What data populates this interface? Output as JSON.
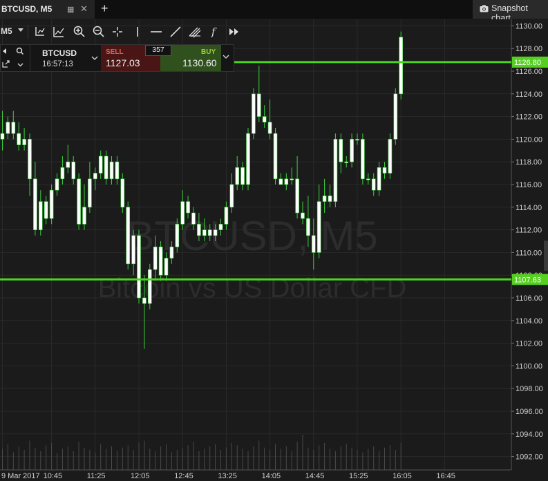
{
  "tab": {
    "title": "BTCUSD, M5",
    "grid_icon": "grid-icon",
    "close_icon": "close-icon"
  },
  "add_tab_icon": "plus-icon",
  "snapshot": {
    "label": "Snapshot chart",
    "icon": "camera-icon"
  },
  "toolbar": {
    "timeframe": "M5",
    "tools": [
      "chart-type-icon",
      "indicators-icon",
      "zoom-in-icon",
      "zoom-out-icon",
      "crosshair-icon",
      "vertical-line-icon",
      "horizontal-line-icon",
      "trend-line-icon",
      "fibonacci-icon",
      "function-icon",
      "fast-forward-icon"
    ]
  },
  "trade_panel": {
    "symbol": "BTCUSD",
    "time": "16:57:13",
    "sell_label": "SELL",
    "sell_price": "1127.03",
    "spread": "357",
    "buy_label": "BUY",
    "buy_price": "1130.60"
  },
  "colors": {
    "background": "#1b1b1b",
    "bull_candle": "#ffffff",
    "bear_candle": "#ffffff",
    "wick": "#3cd23c",
    "level_line": "#4bd61c",
    "level_label_bg": "#55d020"
  },
  "chart_data": {
    "type": "candlestick",
    "watermark_title": "BTCUSD, M5",
    "watermark_subtitle": "Bitcoin vs US Dollar CFD",
    "ylim": [
      1091,
      1131
    ],
    "y_ticks": [
      "1130.00",
      "1128.00",
      "1126.00",
      "1124.00",
      "1122.00",
      "1120.00",
      "1118.00",
      "1116.00",
      "1114.00",
      "1112.00",
      "1110.00",
      "1108.00",
      "1106.00",
      "1104.00",
      "1102.00",
      "1100.00",
      "1098.00",
      "1096.00",
      "1094.00",
      "1092.00"
    ],
    "x_ticks": [
      {
        "i": 0,
        "label": "9 Mar 2017"
      },
      {
        "i": 9,
        "label": "10:45"
      },
      {
        "i": 17,
        "label": "11:25"
      },
      {
        "i": 25,
        "label": "12:05"
      },
      {
        "i": 33,
        "label": "12:45"
      },
      {
        "i": 41,
        "label": "13:25"
      },
      {
        "i": 49,
        "label": "14:05"
      },
      {
        "i": 57,
        "label": "14:45"
      },
      {
        "i": 65,
        "label": "15:25"
      },
      {
        "i": 73,
        "label": "16:05"
      },
      {
        "i": 81,
        "label": "16:45"
      }
    ],
    "levels": [
      {
        "value": 1126.8,
        "label": "1126.80"
      },
      {
        "value": 1107.63,
        "label": "1107.63"
      }
    ],
    "candles": [
      [
        1120.0,
        1122.5,
        1119.0,
        1120.5
      ],
      [
        1120.5,
        1122.0,
        1120.0,
        1121.5
      ],
      [
        1121.5,
        1122.5,
        1120.0,
        1120.5
      ],
      [
        1120.5,
        1121.5,
        1119.0,
        1119.5
      ],
      [
        1119.5,
        1121.0,
        1119.0,
        1120.0
      ],
      [
        1120.0,
        1120.5,
        1115.0,
        1116.5
      ],
      [
        1116.5,
        1118.0,
        1111.5,
        1112.0
      ],
      [
        1112.0,
        1115.5,
        1111.5,
        1114.5
      ],
      [
        1114.5,
        1115.0,
        1112.5,
        1113.0
      ],
      [
        1113.0,
        1116.0,
        1112.5,
        1115.5
      ],
      [
        1115.5,
        1117.0,
        1115.0,
        1116.5
      ],
      [
        1116.5,
        1118.5,
        1116.0,
        1117.5
      ],
      [
        1117.5,
        1119.5,
        1117.0,
        1118.0
      ],
      [
        1118.0,
        1118.5,
        1116.0,
        1116.5
      ],
      [
        1116.5,
        1117.0,
        1112.0,
        1112.5
      ],
      [
        1112.5,
        1116.0,
        1112.0,
        1114.0
      ],
      [
        1114.0,
        1118.0,
        1113.5,
        1116.5
      ],
      [
        1116.5,
        1117.5,
        1115.5,
        1117.0
      ],
      [
        1117.0,
        1119.0,
        1116.5,
        1118.5
      ],
      [
        1118.5,
        1119.0,
        1116.0,
        1116.5
      ],
      [
        1116.5,
        1118.5,
        1116.0,
        1118.0
      ],
      [
        1118.0,
        1118.5,
        1116.0,
        1116.5
      ],
      [
        1116.5,
        1117.0,
        1113.5,
        1114.0
      ],
      [
        1114.0,
        1114.5,
        1108.5,
        1109.0
      ],
      [
        1109.0,
        1112.0,
        1108.0,
        1111.5
      ],
      [
        1111.5,
        1112.0,
        1105.5,
        1106.0
      ],
      [
        1106.0,
        1108.0,
        1101.5,
        1105.5
      ],
      [
        1105.5,
        1109.0,
        1105.0,
        1108.5
      ],
      [
        1108.5,
        1111.5,
        1107.5,
        1110.5
      ],
      [
        1110.5,
        1111.0,
        1107.5,
        1108.0
      ],
      [
        1108.0,
        1110.0,
        1107.5,
        1109.5
      ],
      [
        1109.5,
        1111.0,
        1109.0,
        1110.5
      ],
      [
        1110.5,
        1113.0,
        1110.0,
        1112.5
      ],
      [
        1112.5,
        1115.5,
        1112.0,
        1114.5
      ],
      [
        1114.5,
        1115.0,
        1113.0,
        1113.5
      ],
      [
        1113.5,
        1114.0,
        1112.0,
        1112.5
      ],
      [
        1112.5,
        1113.5,
        1111.0,
        1111.5
      ],
      [
        1111.5,
        1113.0,
        1111.0,
        1112.0
      ],
      [
        1112.0,
        1112.5,
        1111.0,
        1111.5
      ],
      [
        1111.5,
        1112.5,
        1111.0,
        1112.0
      ],
      [
        1112.0,
        1113.0,
        1111.5,
        1112.5
      ],
      [
        1112.5,
        1114.5,
        1112.0,
        1114.0
      ],
      [
        1114.0,
        1117.0,
        1113.5,
        1116.0
      ],
      [
        1116.0,
        1118.5,
        1115.5,
        1117.5
      ],
      [
        1117.5,
        1118.0,
        1115.5,
        1116.0
      ],
      [
        1116.0,
        1121.0,
        1115.5,
        1120.5
      ],
      [
        1120.5,
        1124.5,
        1120.0,
        1124.0
      ],
      [
        1124.0,
        1126.5,
        1121.5,
        1122.0
      ],
      [
        1122.0,
        1123.0,
        1121.0,
        1121.5
      ],
      [
        1121.5,
        1123.5,
        1120.0,
        1120.5
      ],
      [
        1120.5,
        1121.0,
        1116.0,
        1116.5
      ],
      [
        1116.5,
        1117.0,
        1116.0,
        1116.0
      ],
      [
        1116.0,
        1117.0,
        1115.5,
        1116.5
      ],
      [
        1116.5,
        1117.5,
        1116.0,
        1116.5
      ],
      [
        1116.5,
        1118.5,
        1113.0,
        1113.5
      ],
      [
        1113.5,
        1114.5,
        1112.5,
        1113.0
      ],
      [
        1113.0,
        1115.0,
        1110.5,
        1111.5
      ],
      [
        1111.5,
        1113.0,
        1108.5,
        1110.0
      ],
      [
        1110.0,
        1116.0,
        1109.5,
        1114.5
      ],
      [
        1114.5,
        1116.5,
        1113.5,
        1115.0
      ],
      [
        1115.0,
        1116.0,
        1114.0,
        1114.5
      ],
      [
        1114.5,
        1120.5,
        1114.0,
        1120.0
      ],
      [
        1120.0,
        1120.5,
        1117.0,
        1118.0
      ],
      [
        1118.0,
        1118.5,
        1117.5,
        1118.0
      ],
      [
        1118.0,
        1120.5,
        1117.5,
        1120.0
      ],
      [
        1120.0,
        1120.5,
        1119.5,
        1120.0
      ],
      [
        1120.0,
        1120.5,
        1116.0,
        1116.5
      ],
      [
        1116.5,
        1117.0,
        1116.0,
        1116.5
      ],
      [
        1116.5,
        1117.0,
        1115.0,
        1115.5
      ],
      [
        1115.5,
        1118.0,
        1115.0,
        1117.5
      ],
      [
        1117.5,
        1118.0,
        1116.5,
        1117.0
      ],
      [
        1117.0,
        1120.5,
        1116.5,
        1120.0
      ],
      [
        1120.0,
        1124.5,
        1119.5,
        1124.0
      ],
      [
        1124.0,
        1129.5,
        1123.5,
        1129.0
      ]
    ],
    "volumes": [
      18,
      22,
      15,
      20,
      17,
      25,
      19,
      16,
      21,
      23,
      14,
      18,
      20,
      16,
      24,
      19,
      17,
      15,
      22,
      18,
      20,
      16,
      19,
      21,
      17,
      23,
      25,
      18,
      16,
      20,
      22,
      15,
      17,
      19,
      21,
      24,
      16,
      18,
      20,
      22,
      17,
      19,
      23,
      21,
      18,
      16,
      20,
      25,
      19,
      17,
      22,
      18,
      20,
      16,
      24,
      30,
      19,
      17,
      21,
      23,
      18,
      16,
      20,
      22,
      19,
      17,
      15,
      18,
      20,
      16,
      19,
      21,
      17,
      23
    ]
  }
}
